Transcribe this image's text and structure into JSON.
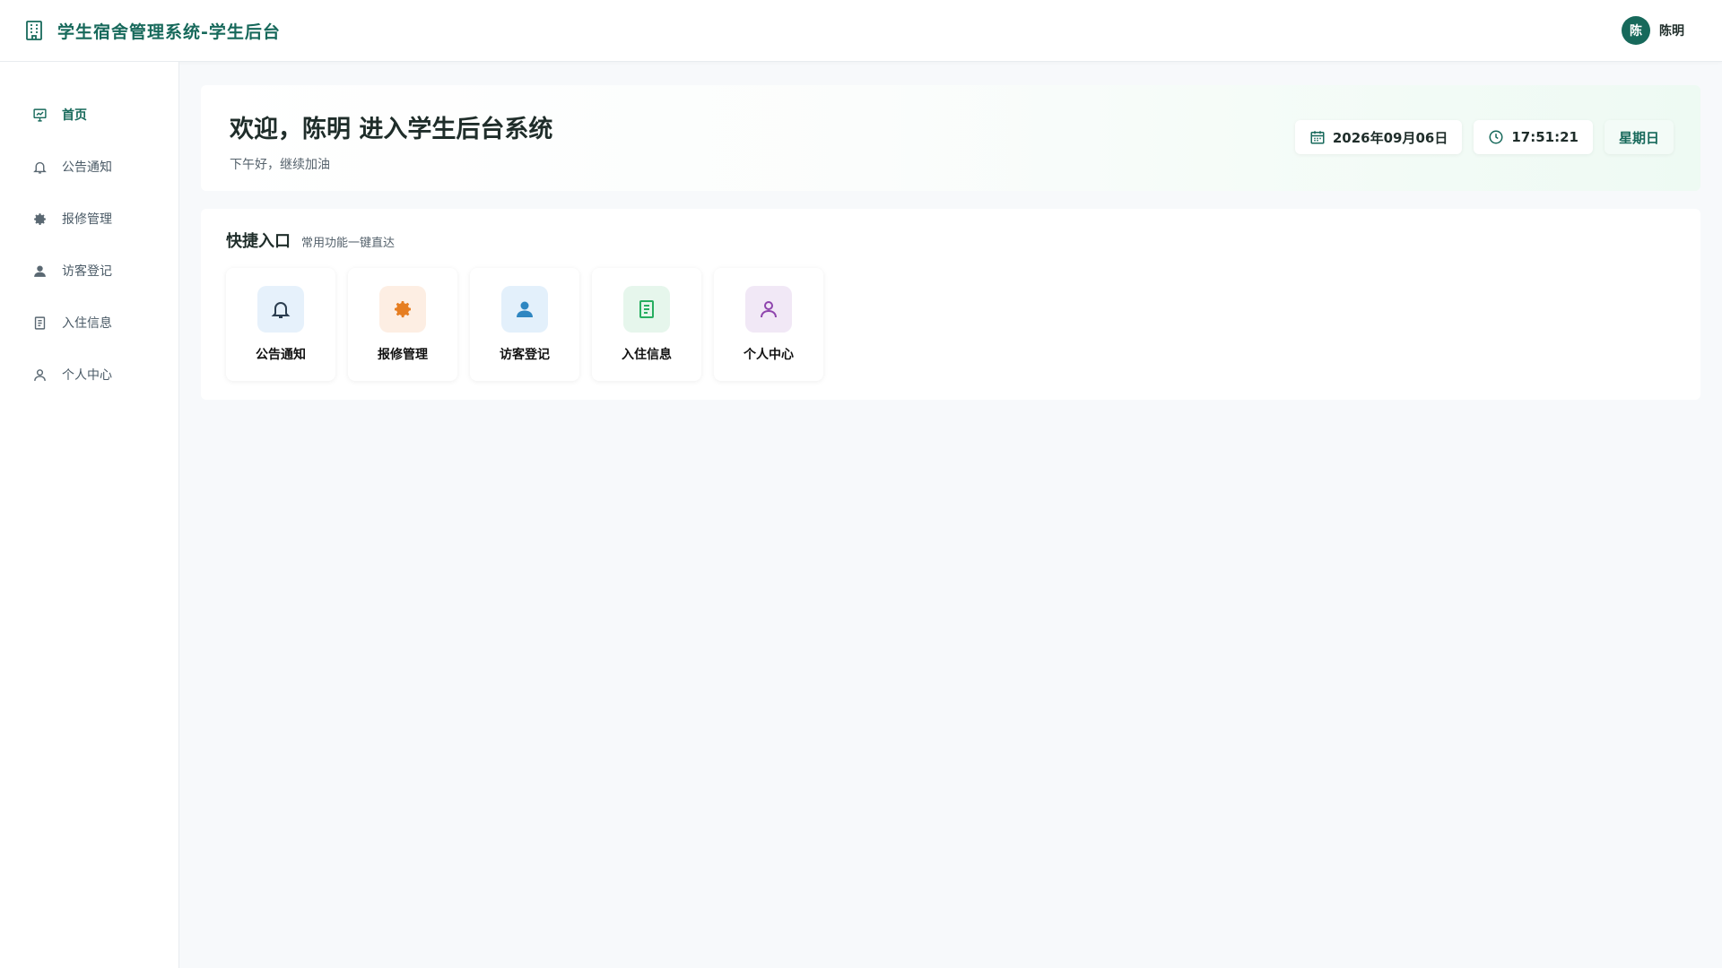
{
  "header": {
    "title": "学生宿舍管理系统-学生后台",
    "brand_icon": "building-icon",
    "user": {
      "avatar_text": "陈",
      "name": "陈明"
    }
  },
  "sidebar": {
    "items": [
      {
        "label": "首页",
        "icon": "presentation-chart-icon",
        "active": true
      },
      {
        "label": "公告通知",
        "icon": "bell-icon",
        "active": false
      },
      {
        "label": "报修管理",
        "icon": "gear-icon",
        "active": false
      },
      {
        "label": "访客登记",
        "icon": "user-filled-icon",
        "active": false
      },
      {
        "label": "入住信息",
        "icon": "document-icon",
        "active": false
      },
      {
        "label": "个人中心",
        "icon": "user-outline-icon",
        "active": false
      }
    ]
  },
  "welcome": {
    "title": "欢迎，陈明 进入学生后台系统",
    "subtitle": "下午好，继续加油",
    "date": "2026年09月06日",
    "time": "17:51:21",
    "weekday": "星期日"
  },
  "quick": {
    "title": "快捷入口",
    "subtitle": "常用功能一键直达",
    "cards": [
      {
        "label": "公告通知",
        "icon": "bell-icon",
        "bg": "#e6f1fb",
        "color": "#2c3e50"
      },
      {
        "label": "报修管理",
        "icon": "gear-icon",
        "bg": "#fdeee3",
        "color": "#e67e22"
      },
      {
        "label": "访客登记",
        "icon": "user-filled-icon",
        "bg": "#e3f0fb",
        "color": "#2e86c1"
      },
      {
        "label": "入住信息",
        "icon": "document-icon",
        "bg": "#e6f6ec",
        "color": "#27ae60"
      },
      {
        "label": "个人中心",
        "icon": "user-outline-icon",
        "bg": "#f1e8f6",
        "color": "#8e44ad"
      }
    ]
  },
  "colors": {
    "primary": "#17695b",
    "background": "#f7f9fb"
  }
}
